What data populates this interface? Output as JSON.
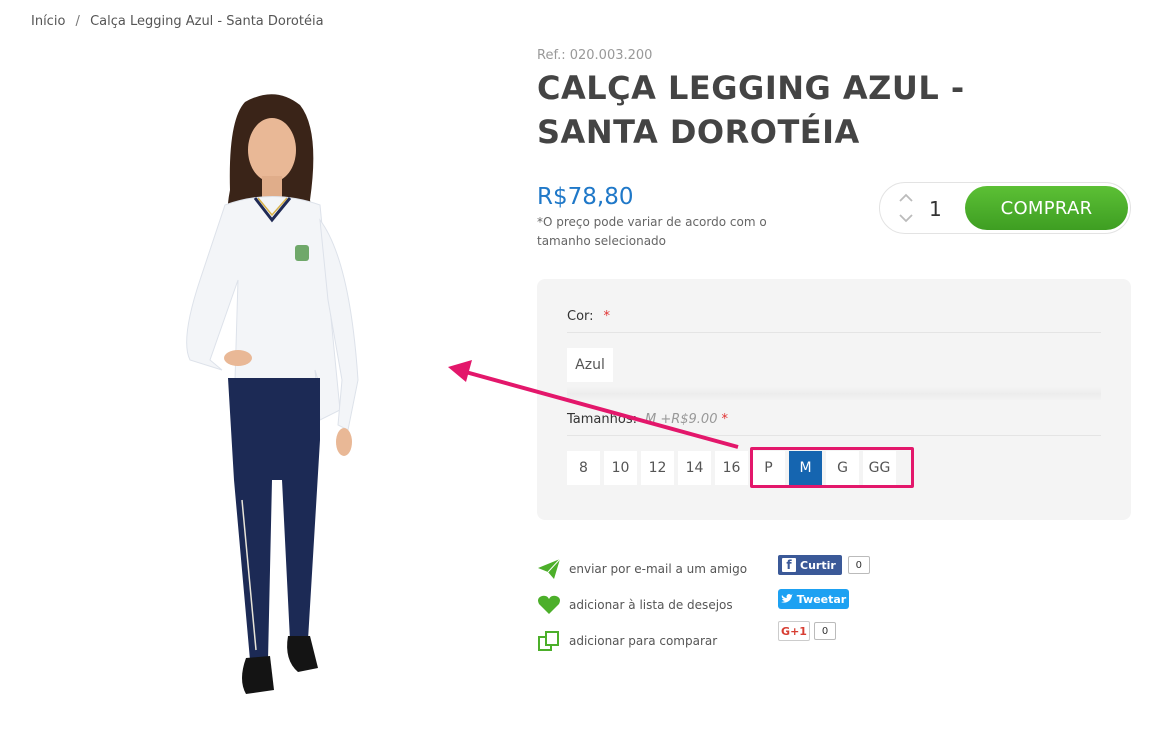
{
  "breadcrumb": {
    "home": "Início",
    "separator": "/",
    "current": "Calça Legging Azul - Santa Dorotéia"
  },
  "product": {
    "ref": "Ref.: 020.003.200",
    "title": "CALÇA LEGGING AZUL - SANTA DOROTÉIA",
    "price": "R$78,80",
    "price_note": "*O preço pode variar de acordo com o tamanho selecionado",
    "image_icon": "student-uniform-photo"
  },
  "buy": {
    "quantity": "1",
    "button_label": "COMPRAR",
    "accent": "#4caf2a"
  },
  "options": {
    "color": {
      "label": "Cor:",
      "required": "*",
      "values": [
        "Azul"
      ]
    },
    "size": {
      "label": "Tamanhos:",
      "hint": "M +R$9.00",
      "required": "*",
      "values": [
        "8",
        "10",
        "12",
        "14",
        "16",
        "P",
        "M",
        "G",
        "GG"
      ],
      "selected": "M"
    }
  },
  "actions": [
    {
      "icon": "paper-plane-icon",
      "label": "enviar por e-mail a um amigo"
    },
    {
      "icon": "heart-icon",
      "label": "adicionar à lista de desejos"
    },
    {
      "icon": "compare-icon",
      "label": "adicionar para comparar"
    }
  ],
  "social": {
    "facebook": {
      "label": "Curtir",
      "count": "0"
    },
    "twitter": {
      "label": "Tweetar"
    },
    "gplus": {
      "label": "G+1",
      "count": "0"
    }
  },
  "colors": {
    "price": "#1f78c8",
    "selected": "#1565b0",
    "highlight": "#e3176b",
    "icons": "#4caf2a"
  }
}
